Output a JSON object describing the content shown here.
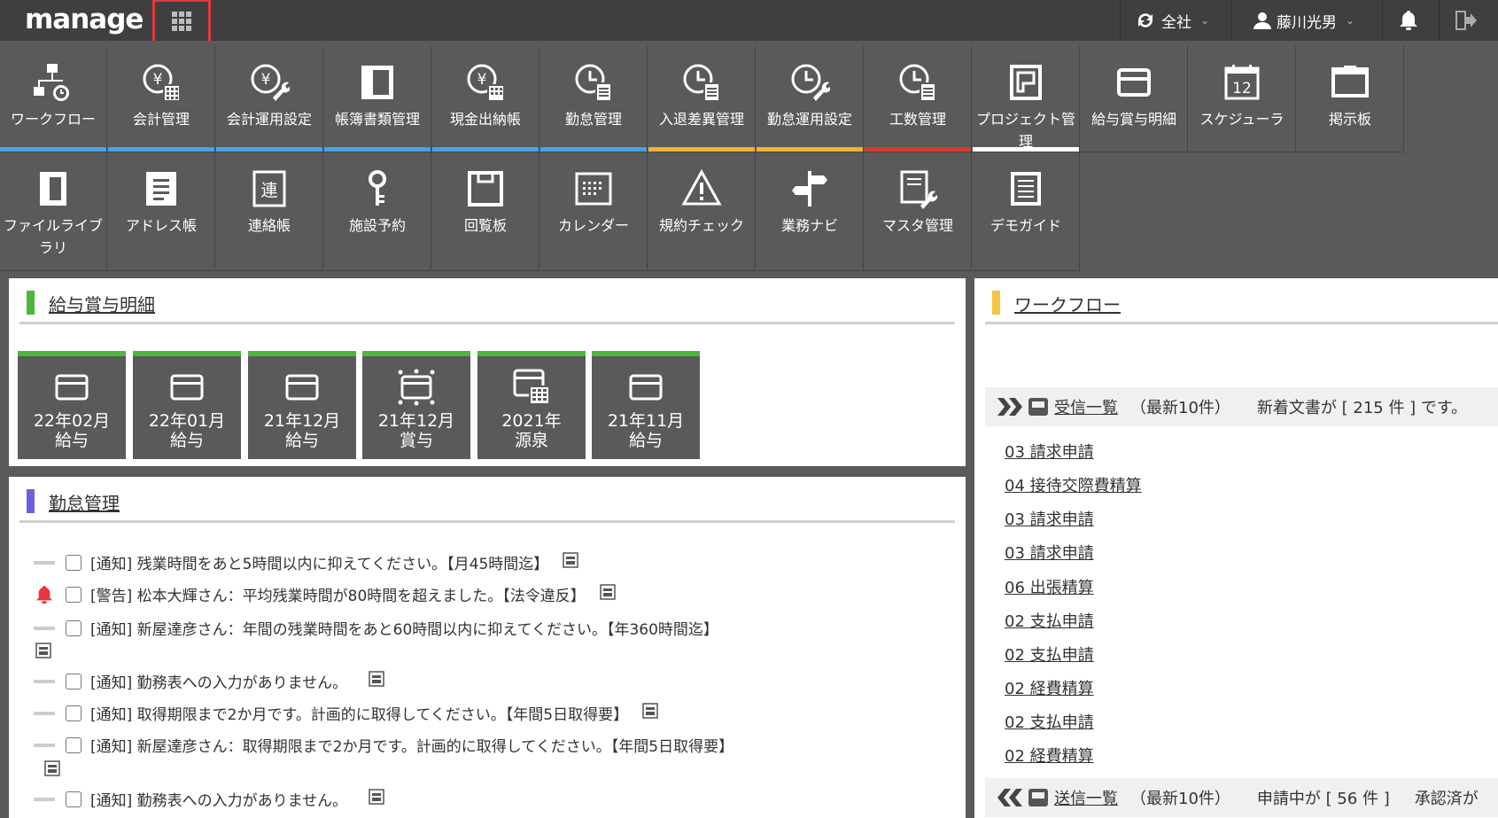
{
  "app": {
    "logo": "manage"
  },
  "topbar": {
    "scope_label": "全社",
    "user_name": "藤川光男"
  },
  "menu": {
    "row1": [
      {
        "label": "ワークフロー",
        "icon": "workflow-icon"
      },
      {
        "label": "会計管理",
        "icon": "yen-calc-icon"
      },
      {
        "label": "会計運用設定",
        "icon": "yen-wrench-icon"
      },
      {
        "label": "帳簿書類管理",
        "icon": "book-icon"
      },
      {
        "label": "現金出納帳",
        "icon": "yen-calc-icon"
      },
      {
        "label": "勤怠管理",
        "icon": "clock-doc-icon"
      },
      {
        "label": "入退差異管理",
        "icon": "clock-doc-icon"
      },
      {
        "label": "勤怠運用設定",
        "icon": "clock-wrench-icon"
      },
      {
        "label": "工数管理",
        "icon": "clock-doc-icon"
      },
      {
        "label": "プロジェクト管理",
        "icon": "project-icon"
      },
      {
        "label": "給与賞与明細",
        "icon": "payslip-icon"
      },
      {
        "label": "スケジューラ",
        "icon": "calendar-12-icon"
      },
      {
        "label": "掲示板",
        "icon": "board-icon"
      }
    ],
    "row2": [
      {
        "label": "ファイルライブラリ",
        "icon": "file-icon"
      },
      {
        "label": "アドレス帳",
        "icon": "address-icon"
      },
      {
        "label": "連絡帳",
        "icon": "contact-book-icon"
      },
      {
        "label": "施設予約",
        "icon": "key-icon"
      },
      {
        "label": "回覧板",
        "icon": "circular-icon"
      },
      {
        "label": "カレンダー",
        "icon": "calendar-icon"
      },
      {
        "label": "規約チェック",
        "icon": "warning-icon"
      },
      {
        "label": "業務ナビ",
        "icon": "signpost-icon"
      },
      {
        "label": "マスタ管理",
        "icon": "master-icon"
      },
      {
        "label": "デモガイド",
        "icon": "guide-icon"
      }
    ]
  },
  "payslip": {
    "title": "給与賞与明細",
    "tiles": [
      {
        "l1": "22年02月",
        "l2": "給与",
        "icon": "payslip-icon"
      },
      {
        "l1": "22年01月",
        "l2": "給与",
        "icon": "payslip-icon"
      },
      {
        "l1": "21年12月",
        "l2": "給与",
        "icon": "payslip-icon"
      },
      {
        "l1": "21年12月",
        "l2": "賞与",
        "icon": "bonus-icon"
      },
      {
        "l1": "2021年",
        "l2": "源泉",
        "icon": "withholding-icon"
      },
      {
        "l1": "21年11月",
        "l2": "給与",
        "icon": "payslip-icon"
      }
    ]
  },
  "attendance": {
    "title": "勤怠管理",
    "notices": [
      {
        "text": "[通知] 残業時間をあと5時間以内に抑えてください。【月45時間迄】",
        "alert": false
      },
      {
        "text": "[警告] 松本大輝さん：平均残業時間が80時間を超えました。【法令違反】",
        "alert": true
      },
      {
        "text": "[通知] 新屋達彦さん：年間の残業時間をあと60時間以内に抑えてください。【年360時間迄】",
        "alert": false
      },
      {
        "text": "[通知] 勤務表への入力がありません。",
        "alert": false
      },
      {
        "text": "[通知] 取得期限まで2か月です。計画的に取得してください。【年間5日取得要】",
        "alert": false
      },
      {
        "text": "[通知] 新屋達彦さん：取得期限まで2か月です。計画的に取得してください。【年間5日取得要】",
        "alert": false
      },
      {
        "text": "[通知] 勤務表への入力がありません。",
        "alert": false
      }
    ]
  },
  "workflow": {
    "title": "ワークフロー",
    "inbox": {
      "label": "受信一覧",
      "latest": "（最新10件）",
      "message": "新着文書が [ 215 件 ] です。"
    },
    "items": [
      "03 請求申請",
      "04 接待交際費精算",
      "03 請求申請",
      "03 請求申請",
      "06 出張精算",
      "02 支払申請",
      "02 支払申請",
      "02 経費精算",
      "02 支払申請",
      "02 経費精算"
    ],
    "outbox": {
      "label": "送信一覧",
      "latest": "（最新10件）",
      "message": "申請中が [ 56 件 ]",
      "extra": "承認済が"
    }
  },
  "colors": {
    "orange": "#f2b233",
    "purple": "#6a5fe0",
    "green": "#4cb83b",
    "blue": "#47a3e8",
    "red": "#d93a2b",
    "yellow": "#f4c542",
    "white": "#ffffff",
    "gray": "#8a8a8a"
  }
}
